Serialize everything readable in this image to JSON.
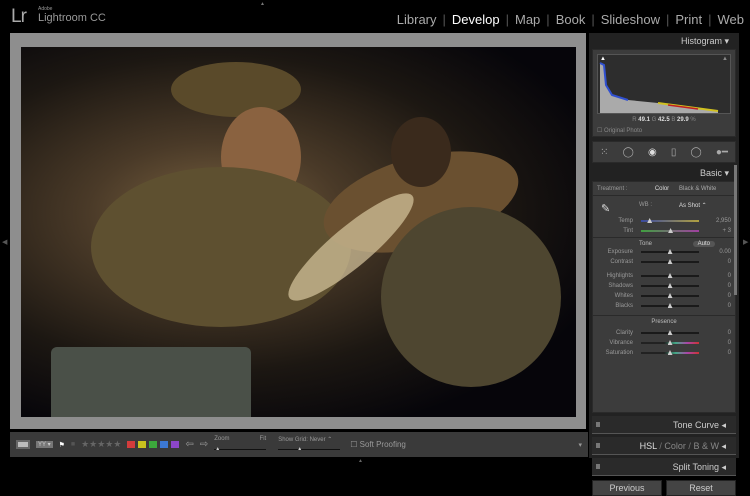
{
  "app": {
    "logo": "Lr",
    "vendor": "Adobe",
    "name": "Lightroom CC"
  },
  "modules": [
    {
      "label": "Library"
    },
    {
      "label": "Develop",
      "active": true
    },
    {
      "label": "Map"
    },
    {
      "label": "Book"
    },
    {
      "label": "Slideshow"
    },
    {
      "label": "Print"
    },
    {
      "label": "Web"
    }
  ],
  "histogram": {
    "title": "Histogram",
    "r_label": "R",
    "r": "49.1",
    "g_label": "G",
    "g": "42.5",
    "b_label": "B",
    "b": "29.9",
    "pct": "%",
    "original_photo": "Original Photo"
  },
  "basic": {
    "title": "Basic",
    "treatment_label": "Treatment :",
    "color": "Color",
    "bw": "Black & White",
    "wb_label": "WB :",
    "wb_value": "As Shot",
    "temp": {
      "label": "Temp",
      "value": "2,950",
      "pos": 0.15
    },
    "tint": {
      "label": "Tint",
      "value": "+ 3",
      "pos": 0.51
    },
    "tone_label": "Tone",
    "auto": "Auto",
    "tone": [
      {
        "label": "Exposure",
        "value": "0.00",
        "pos": 0.5
      },
      {
        "label": "Contrast",
        "value": "0",
        "pos": 0.5
      }
    ],
    "tone2": [
      {
        "label": "Highlights",
        "value": "0",
        "pos": 0.5
      },
      {
        "label": "Shadows",
        "value": "0",
        "pos": 0.5
      },
      {
        "label": "Whites",
        "value": "0",
        "pos": 0.5
      },
      {
        "label": "Blacks",
        "value": "0",
        "pos": 0.5
      }
    ],
    "presence_label": "Presence",
    "presence": [
      {
        "label": "Clarity",
        "value": "0",
        "pos": 0.5
      },
      {
        "label": "Vibrance",
        "value": "0",
        "pos": 0.5
      },
      {
        "label": "Saturation",
        "value": "0",
        "pos": 0.5
      }
    ]
  },
  "sections": {
    "tone_curve": "Tone Curve",
    "hsl": "HSL",
    "color": "Color",
    "bw": "B & W",
    "sep": "/",
    "split_toning": "Split Toning"
  },
  "buttons": {
    "previous": "Previous",
    "reset": "Reset"
  },
  "toolbar": {
    "zoom_label": "Zoom",
    "zoom_fit": "Fit",
    "show_grid_label": "Show Grid:",
    "show_grid_value": "Never",
    "soft_proofing": "Soft Proofing",
    "stars": "★★★★★",
    "labels": [
      "#d23c3c",
      "#c8c21e",
      "#3ca83c",
      "#3c78d2",
      "#8c46c8"
    ]
  },
  "colors": {
    "accent": "#ffffff",
    "panel": "#3c3c3c"
  }
}
